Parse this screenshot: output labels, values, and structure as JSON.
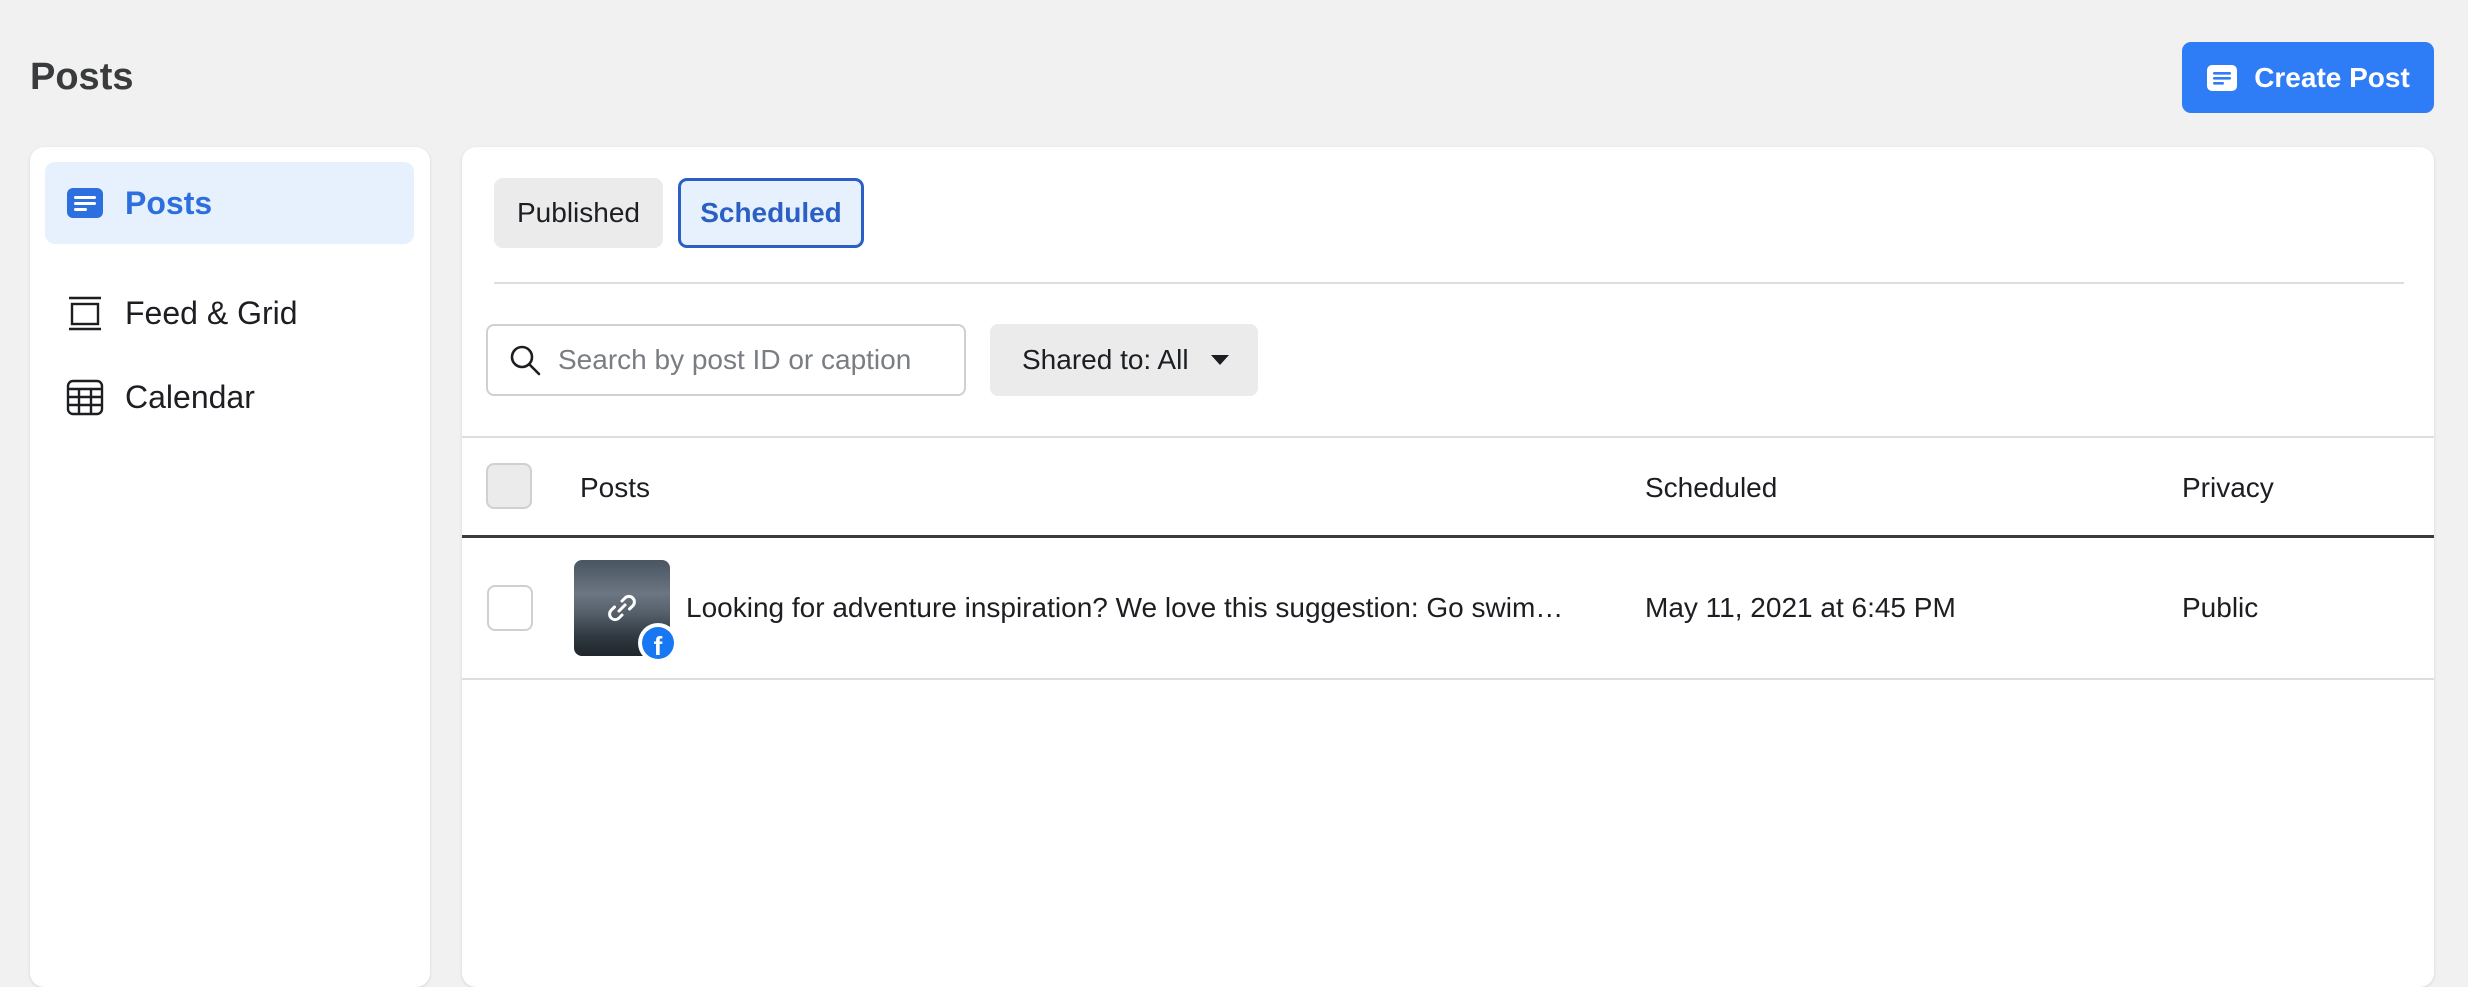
{
  "header": {
    "title": "Posts",
    "create_button_label": "Create Post"
  },
  "sidebar": {
    "items": [
      {
        "label": "Posts",
        "icon": "posts-icon",
        "active": true
      },
      {
        "label": "Feed & Grid",
        "icon": "feed-grid-icon",
        "active": false
      },
      {
        "label": "Calendar",
        "icon": "calendar-icon",
        "active": false
      }
    ]
  },
  "tabs": [
    {
      "label": "Published",
      "selected": false
    },
    {
      "label": "Scheduled",
      "selected": true
    }
  ],
  "search": {
    "placeholder": "Search by post ID or caption",
    "value": ""
  },
  "filter": {
    "label": "Shared to: All"
  },
  "table": {
    "columns": [
      "Posts",
      "Scheduled",
      "Privacy"
    ],
    "rows": [
      {
        "caption": "Looking for adventure inspiration? We love this suggestion: Go swimmin…",
        "scheduled": "May 11, 2021 at 6:45 PM",
        "privacy": "Public",
        "thumbnail_icon": "link-icon",
        "platform_icon": "facebook-icon"
      }
    ]
  },
  "colors": {
    "accent": "#2e7cf6",
    "active_bg": "#e7f0fd",
    "active_text": "#2d6fde",
    "page_bg": "#f1f1f1"
  }
}
